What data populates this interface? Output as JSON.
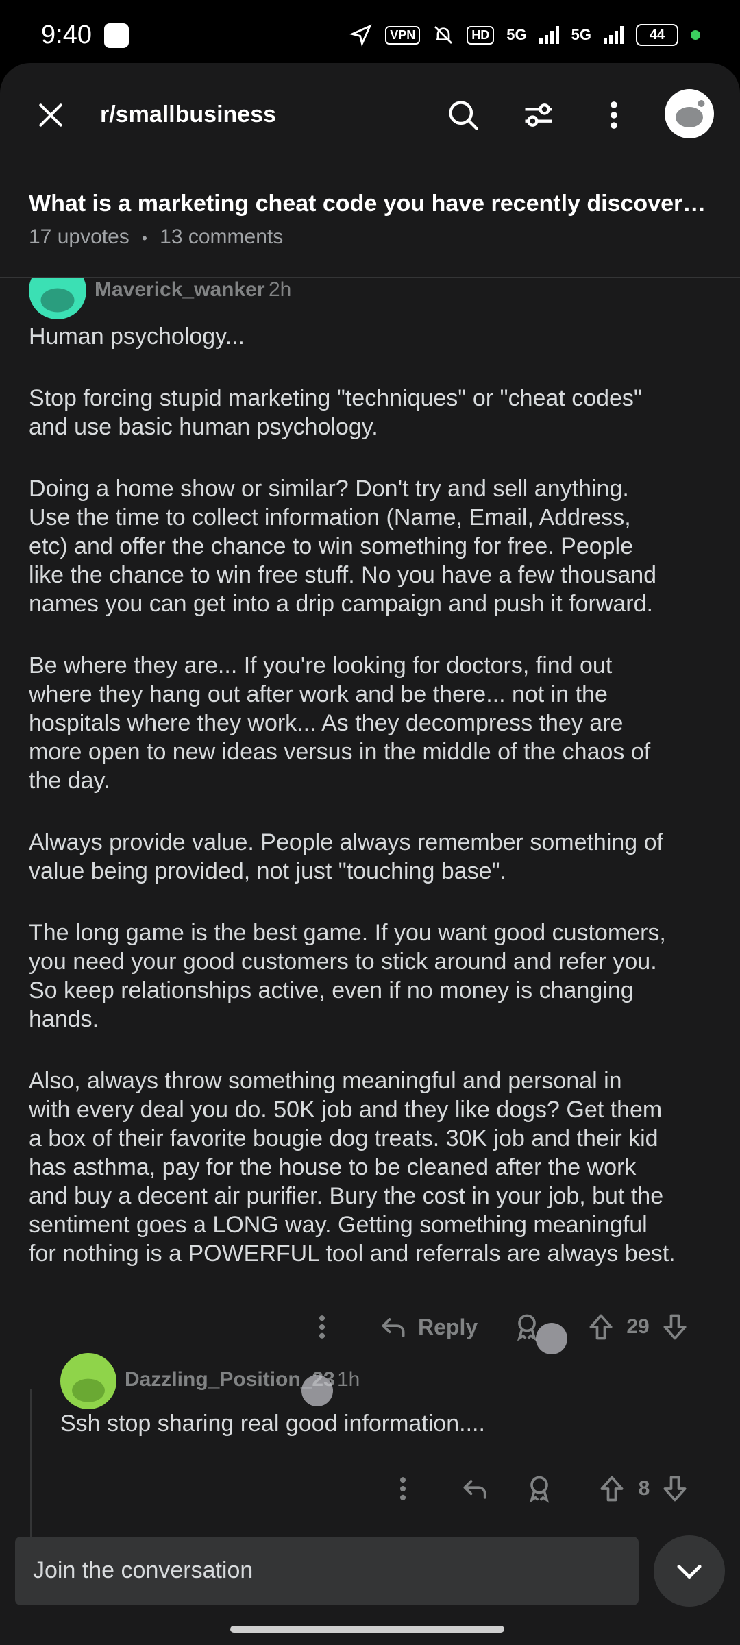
{
  "status_bar": {
    "time": "9:40",
    "vpn": "VPN",
    "hd": "HD",
    "net1": "5G",
    "net2": "5G",
    "battery": "44"
  },
  "header": {
    "subreddit": "r/smallbusiness",
    "icons": [
      "close-icon",
      "search-icon",
      "filter-icon",
      "more-vertical-icon",
      "avatar"
    ]
  },
  "post": {
    "title": "What is a marketing cheat code you have recently discovered?",
    "upvotes": "17 upvotes",
    "separator": "•",
    "comments": "13 comments"
  },
  "comment1": {
    "author": "Maverick_wanker",
    "time": "2h",
    "paragraphs": [
      "Human psychology...",
      "Stop forcing stupid marketing \"techniques\" or \"cheat codes\"\nand use basic human psychology.",
      "Doing a home show or similar? Don't try and sell anything.\nUse the time to collect information (Name, Email, Address,\netc) and offer the chance to win something for free. People\nlike the chance to win free stuff. No you have a few thousand\nnames you can get into a drip campaign and push it forward.",
      "Be where they are... If you're looking for doctors, find out\nwhere they hang out after work and be there... not in the\nhospitals where they work... As they decompress they are\nmore open to new ideas versus in the middle of the chaos of\nthe day.",
      "Always provide value. People always remember something of\nvalue being provided, not just \"touching base\".",
      "The long game is the best game. If you want good customers,\nyou need your good customers to stick around and refer you.\nSo keep relationships active, even if no money is changing\nhands.",
      "Also, always throw something meaningful and personal in\nwith every deal you do. 50K job and they like dogs? Get them\na box of their favorite bougie dog treats. 30K job and their kid\nhas asthma, pay for the house to be cleaned after the work\nand buy a decent air purifier. Bury the cost in your job, but the\nsentiment goes a LONG way. Getting something meaningful\nfor nothing is a POWERFUL tool and referrals are always best."
    ],
    "reply_label": "Reply",
    "votes": "29"
  },
  "comment2": {
    "author": "Dazzling_Position_23",
    "time": "1h",
    "body": "Ssh stop sharing real good information....",
    "votes": "8"
  },
  "composer": {
    "placeholder": "Join the conversation"
  },
  "colors": {
    "sheet_bg": "#1a1a1b",
    "text": "#d7dadc",
    "muted": "#818384",
    "avatar1": "#3be0b4",
    "avatar2": "#8fd44a"
  }
}
